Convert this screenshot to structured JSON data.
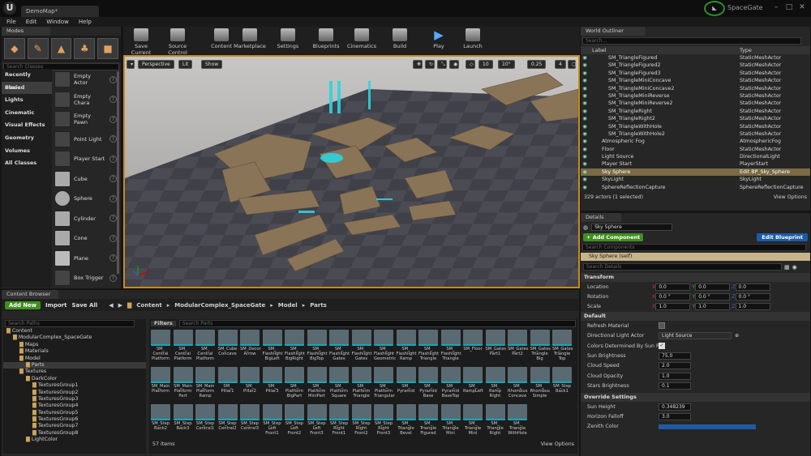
{
  "app": {
    "tab_title": "DemoMap*",
    "project": "SpaceGate",
    "logo": "U"
  },
  "menu": [
    "File",
    "Edit",
    "Window",
    "Help"
  ],
  "modes": {
    "title": "Modes",
    "search_placeholder": "Search Classes",
    "categories": [
      "Recently Placed",
      "Basic",
      "Lights",
      "Cinematic",
      "Visual Effects",
      "Geometry",
      "Volumes",
      "All Classes"
    ],
    "actors": [
      "Empty Actor",
      "Empty Chara",
      "Empty Pawn",
      "Point Light",
      "Player Start",
      "Cube",
      "Sphere",
      "Cylinder",
      "Cone",
      "Plane",
      "Box Trigger"
    ]
  },
  "toolbar": [
    "Save Current",
    "Source Control",
    "Content",
    "Marketplace",
    "Settings",
    "Blueprints",
    "Cinematics",
    "Build",
    "Play",
    "Launch"
  ],
  "viewport": {
    "perspective": "Perspective",
    "lit": "Lit",
    "show": "Show",
    "grid": "10",
    "angle": "10°",
    "scale": "0.25",
    "cam": "4"
  },
  "outliner": {
    "title": "World Outliner",
    "search_placeholder": "Search...",
    "col_label": "Label",
    "col_type": "Type",
    "rows": [
      {
        "label": "SM_TriangleFigured",
        "type": "StaticMeshActor"
      },
      {
        "label": "SM_TriangleFigured2",
        "type": "StaticMeshActor"
      },
      {
        "label": "SM_TriangleFigured3",
        "type": "StaticMeshActor"
      },
      {
        "label": "SM_TriangleMiniConcave",
        "type": "StaticMeshActor"
      },
      {
        "label": "SM_TriangleMiniConcave2",
        "type": "StaticMeshActor"
      },
      {
        "label": "SM_TriangleMiniReverse",
        "type": "StaticMeshActor"
      },
      {
        "label": "SM_TriangleMiniReverse2",
        "type": "StaticMeshActor"
      },
      {
        "label": "SM_TriangleRight",
        "type": "StaticMeshActor"
      },
      {
        "label": "SM_TriangleRight2",
        "type": "StaticMeshActor"
      },
      {
        "label": "SM_TriangleWithHole",
        "type": "StaticMeshActor"
      },
      {
        "label": "SM_TriangleWithHole2",
        "type": "StaticMeshActor"
      },
      {
        "label": "Atmospheric Fog",
        "type": "AtmosphericFog"
      },
      {
        "label": "Floor",
        "type": "StaticMeshActor"
      },
      {
        "label": "Light Source",
        "type": "DirectionalLight"
      },
      {
        "label": "Player Start",
        "type": "PlayerStart"
      },
      {
        "label": "Sky Sphere",
        "type": "Edit BP_Sky_Sphere"
      },
      {
        "label": "SkyLight",
        "type": "SkyLight"
      },
      {
        "label": "SphereReflectionCapture",
        "type": "SphereReflectionCapture"
      }
    ],
    "count": "329 actors (1 selected)",
    "view_options": "View Options"
  },
  "details": {
    "title": "Details",
    "name": "Sky Sphere",
    "add_component": "+ Add Component",
    "edit_blueprint": "Edit Blueprint",
    "self": "Sky Sphere (self)",
    "search_components": "Search Components",
    "search_details": "Search Details",
    "transform": "Transform",
    "location": "Location",
    "rotation": "Rotation",
    "scale": "Scale",
    "loc": [
      "0.0",
      "0.0",
      "0.0"
    ],
    "rot": [
      "0.0 °",
      "0.0 °",
      "0.0 °"
    ],
    "scl": [
      "1.0",
      "1.0",
      "1.0"
    ],
    "default": "Default",
    "refresh": "Refresh Material",
    "dir_light": "Directional Light Actor",
    "light_source": "Light Source",
    "colors_det": "Colors Determined By Sun Positi",
    "sun_brightness": "Sun Brightness",
    "sun_brightness_v": "75.0",
    "cloud_speed": "Cloud Speed",
    "cloud_speed_v": "2.0",
    "cloud_opacity": "Cloud Opacity",
    "cloud_opacity_v": "1.0",
    "stars": "Stars Brightness",
    "stars_v": "0.1",
    "override": "Override Settings",
    "sun_height": "Sun Height",
    "sun_height_v": "0.348239",
    "horizon": "Horizon Falloff",
    "horizon_v": "3.0",
    "zenith": "Zenith Color"
  },
  "content": {
    "title": "Content Browser",
    "add_new": "Add New",
    "import": "Import",
    "save_all": "Save All",
    "path": [
      "Content",
      "ModularComplex_SpaceGate",
      "Model",
      "Parts"
    ],
    "search_paths": "Search Paths",
    "filters": "Filters",
    "search_parts": "Search Parts",
    "items": "57 items",
    "view_options": "View Options",
    "tree": [
      "Content",
      "ModularComplex_SpaceGate",
      "Maps",
      "Materials",
      "Model",
      "Parts",
      "Textures",
      "DarkColor",
      "TexturesGroup1",
      "TexturesGroup2",
      "TexturesGroup3",
      "TexturesGroup4",
      "TexturesGroup5",
      "TexturesGroup6",
      "TexturesGroup7",
      "TexturesGroup8",
      "LightColor"
    ],
    "assets": [
      "SM_ Central Platform",
      "SM_ Central Platform",
      "SM_ Central Platform",
      "SM_Cube Concave",
      "SM_Decor Arrow",
      "SM_ Flashlight BigLeft",
      "SM_ Flashlight BigRight",
      "SM_ Flashlight BigTop",
      "SM_ Flashlight Gates",
      "SM_ Flashlight Gates",
      "SM_ Flashlight Geometric",
      "SM_ Flashlight Ramp",
      "SM_ Flashlight Triangle",
      "SM_ Flashlight Triangle",
      "SM_Floor",
      "SM_Gates Part1",
      "SM_Gates Part2",
      "SM_Gates Triangle Big",
      "SM_Gates Triangle Top",
      "SM_Main Platform",
      "SM_Main Platform Part",
      "SM_Main Platform Ramp",
      "SM_ Pillar1",
      "SM_ Pillar2",
      "SM_ Pillar3",
      "SM_ Platform BigPart",
      "SM_ Platform MiniPart",
      "SM_ Platform Square",
      "SM_ Platform Triangle",
      "SM_ Platform Triangular",
      "SM_ Pyramid",
      "SM_ Pyramid Base",
      "SM_ Pyramid BaseTop",
      "SM_ RampLeft",
      "SM_ Ramp Right",
      "SM_ Rhombus Concave",
      "SM_ Rhombus Simple",
      "SM_Step Back1",
      "SM_Step Back2",
      "SM_Step Back3",
      "SM_Step Central1",
      "SM_Step Central2",
      "SM_Step Central3",
      "SM_Step Left Front1",
      "SM_Step Left Front2",
      "SM_Step Left Front3",
      "SM_Step Right Front1",
      "SM_Step Right Front2",
      "SM_Step Right Front3",
      "SM_ Triangle Bevel",
      "SM_ Triangle Figured",
      "SM_ Triangle Mini",
      "SM_ Triangle Mini",
      "SM_ Triangle Right",
      "SM_ Triangle WithHole"
    ]
  }
}
